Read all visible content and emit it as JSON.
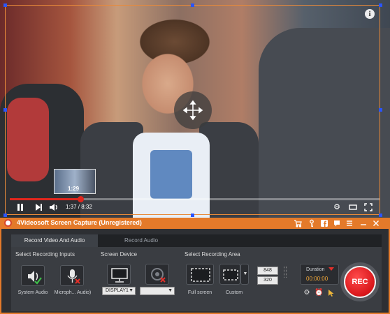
{
  "video": {
    "thumbnail_time": "1:29",
    "time_display": "1:37 / 8:32",
    "progress_fraction": 0.19
  },
  "icons": {
    "info": "i",
    "move": "✥",
    "play_pause": "❚❚",
    "next": "▶❙",
    "volume": "🔊",
    "settings": "⚙",
    "theater": "▭",
    "fullscreen": "⛶"
  },
  "app": {
    "title": "4Videosoft Screen Capture (Unregistered)",
    "accent_color": "#e47a2a",
    "tabs": [
      {
        "label": "Record Video And Audio",
        "active": true
      },
      {
        "label": "Record Audio",
        "active": false
      }
    ],
    "sections": {
      "inputs": "Select Recording Inputs",
      "device": "Screen Device",
      "area": "Select Recording Area"
    },
    "inputs": {
      "system_audio": "System Audio",
      "microphone": "Microph... Audio)"
    },
    "device": {
      "display_select": "DISPLAY1",
      "second_select": ""
    },
    "area": {
      "full_screen": "Full screen",
      "custom": "Custom",
      "width": "848",
      "height": "320"
    },
    "duration": {
      "label": "Duration",
      "value": "00:00:00"
    },
    "rec_label": "REC"
  }
}
